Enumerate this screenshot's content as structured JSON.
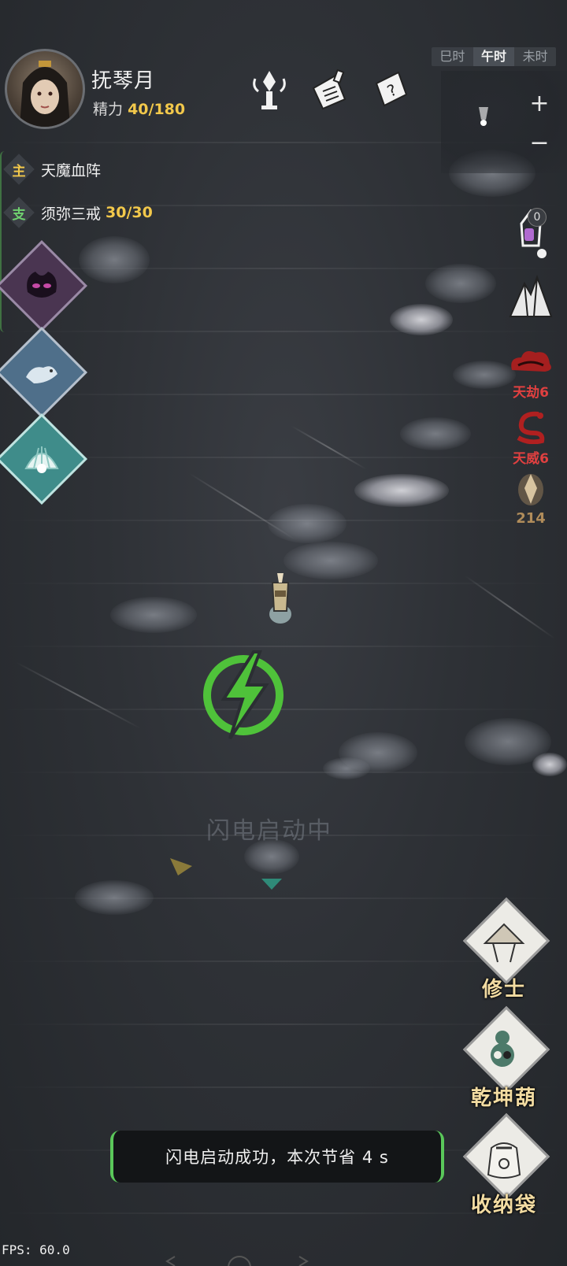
{
  "player": {
    "name": "抚琴月",
    "energy_label": "精力",
    "energy_value": "40/180"
  },
  "time_bar": {
    "segments": [
      "巳时",
      "午时",
      "未时"
    ],
    "active": "午时"
  },
  "zoom": {
    "plus": "+",
    "minus": "−"
  },
  "quests": {
    "main_tag": "主",
    "main_text": "天魔血阵",
    "side_tag": "支",
    "side_text": "须弥三戒",
    "side_count": "30/30"
  },
  "right_panel": {
    "badge_count": "0",
    "tianjie_label": "天劫6",
    "tianwei_label": "天威6",
    "gold_value": "214"
  },
  "menu": {
    "cultivator_label": "修士",
    "gourd_label": "乾坤葫",
    "bag_label": "收纳袋"
  },
  "center": {
    "loading_text": "闪电启动中"
  },
  "toast": {
    "text": "闪电启动成功，本次节省 4 s"
  },
  "fps": "FPS: 60.0",
  "colors": {
    "accent_green": "#5ac85a",
    "energy_gold": "#f2c84b",
    "danger_red": "#e04040",
    "menu_gold": "#f3dca2"
  }
}
